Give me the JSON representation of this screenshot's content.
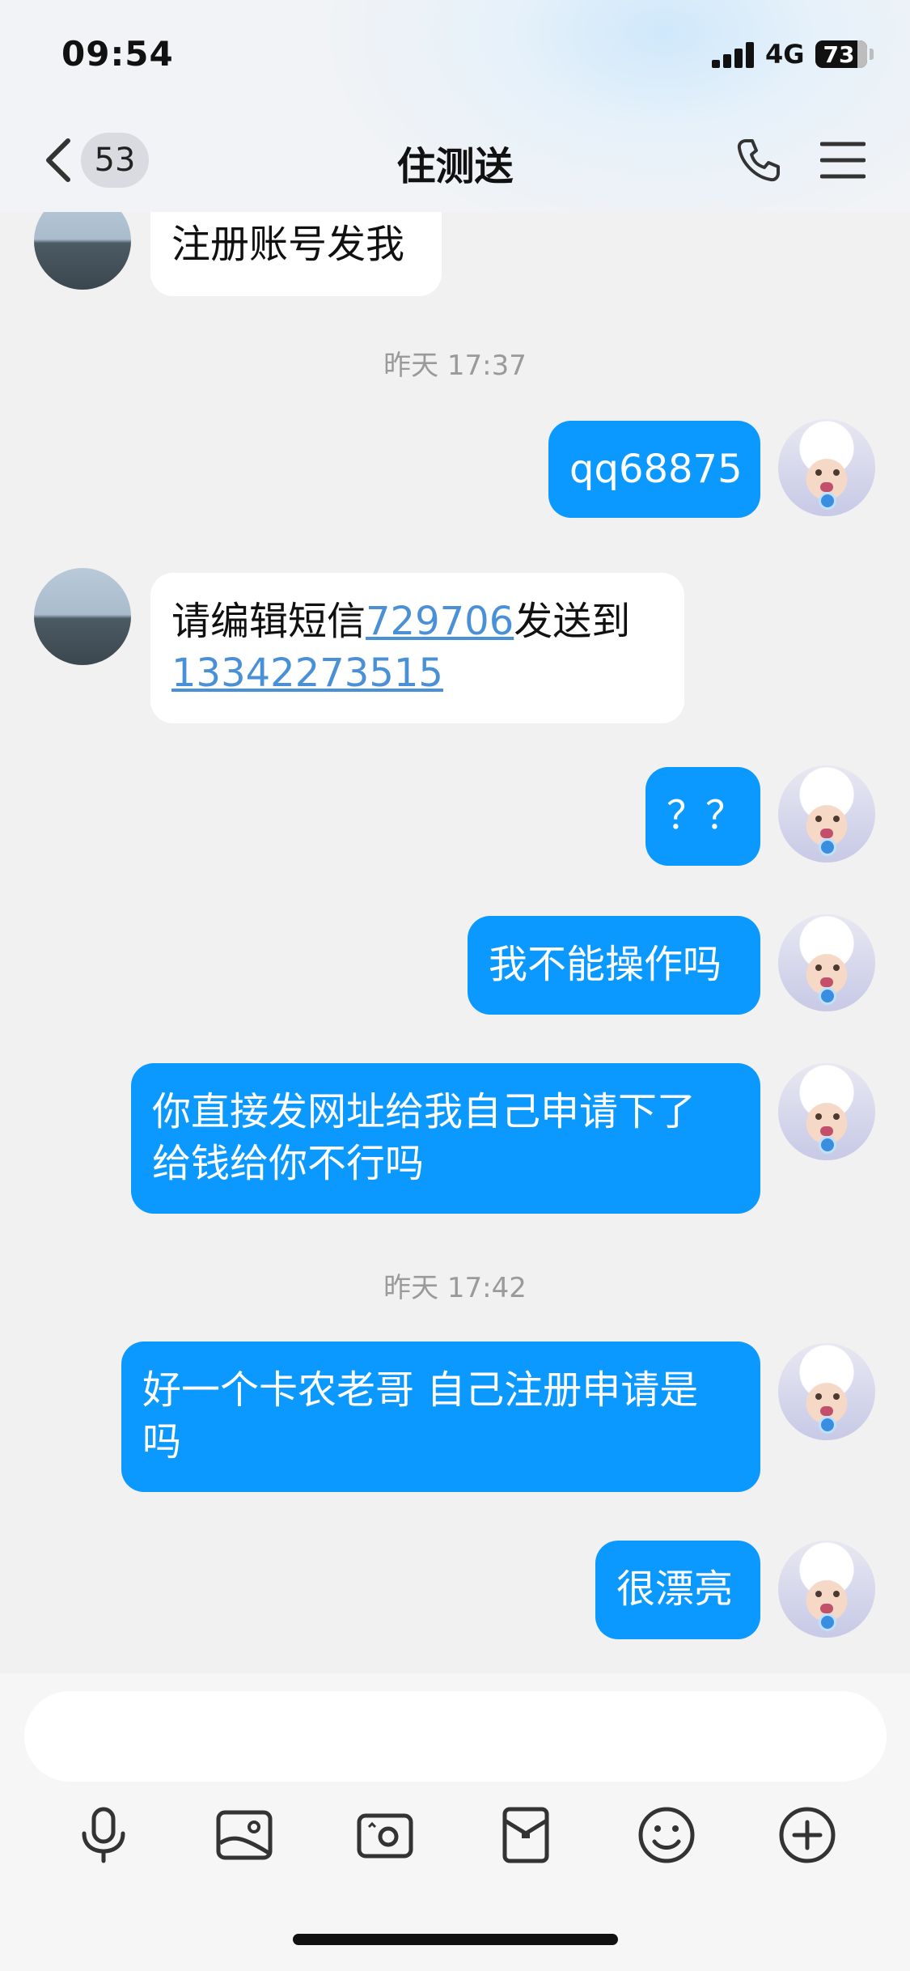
{
  "status_bar": {
    "time": "09:54",
    "network": "4G",
    "battery": "73"
  },
  "header": {
    "unread_count": "53",
    "title": "住测送"
  },
  "messages": {
    "m1": "注册账号发我",
    "ts1": "昨天 17:37",
    "m2": "qq68875",
    "m3_prefix": "请编辑短信",
    "m3_code": "729706",
    "m3_mid": "发送到",
    "m3_phone": "13342273515",
    "m4": "？？",
    "m5": "我不能操作吗",
    "m6_line1": "你直接发网址给我自己申请下了",
    "m6_line2": "给钱给你不行吗",
    "ts2": "昨天 17:42",
    "m7_line1": "好一个卡农老哥 自己注册申请是",
    "m7_line2": "吗",
    "m8": "很漂亮"
  },
  "input": {
    "value": "",
    "placeholder": ""
  },
  "toolbar": [
    "microphone-icon",
    "image-icon",
    "camera-icon",
    "red-packet-icon",
    "emoji-icon",
    "plus-icon"
  ],
  "colors": {
    "outgoing_bubble": "#0b99ff",
    "incoming_bubble": "#ffffff",
    "link": "#4a90d6",
    "background": "#f1f1f1"
  }
}
